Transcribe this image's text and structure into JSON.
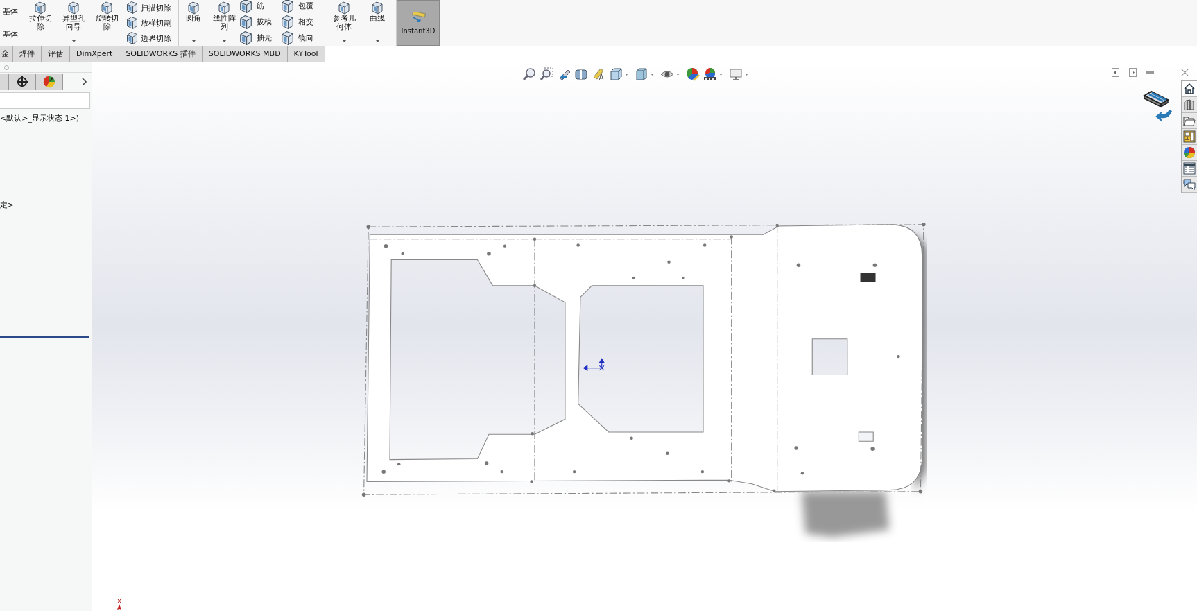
{
  "ribbon": {
    "left_labels": [
      "基体",
      "基体"
    ],
    "groups": [
      {
        "large": [
          {
            "label": "拉伸切除",
            "dropdown": false
          },
          {
            "label": "异型孔向导",
            "dropdown": true
          },
          {
            "label": "旋转切除",
            "dropdown": false
          }
        ],
        "small": [
          "扫描切除",
          "放样切割",
          "边界切除"
        ]
      },
      {
        "large": [
          {
            "label": "圆角",
            "dropdown": true
          },
          {
            "label": "线性阵列",
            "dropdown": true
          }
        ],
        "small": [
          "筋",
          "拔模",
          "抽壳"
        ],
        "small_b": [
          "包覆",
          "相交",
          "镜向"
        ]
      },
      {
        "large": [
          {
            "label": "参考几何体",
            "dropdown": true
          },
          {
            "label": "曲线",
            "dropdown": true
          }
        ]
      }
    ],
    "toggle": {
      "label": "Instant3D",
      "on": true
    }
  },
  "tabs": [
    {
      "label": "金",
      "selected": false
    },
    {
      "label": "焊件",
      "selected": false
    },
    {
      "label": "评估",
      "selected": false
    },
    {
      "label": "DimXpert",
      "selected": false
    },
    {
      "label": "SOLIDWORKS 插件",
      "selected": false
    },
    {
      "label": "SOLIDWORKS MBD",
      "selected": false
    },
    {
      "label": "KYTool",
      "selected": false
    }
  ],
  "feature_tree": {
    "items": [
      "<默认>_显示状态 1>)",
      "定>"
    ]
  }
}
